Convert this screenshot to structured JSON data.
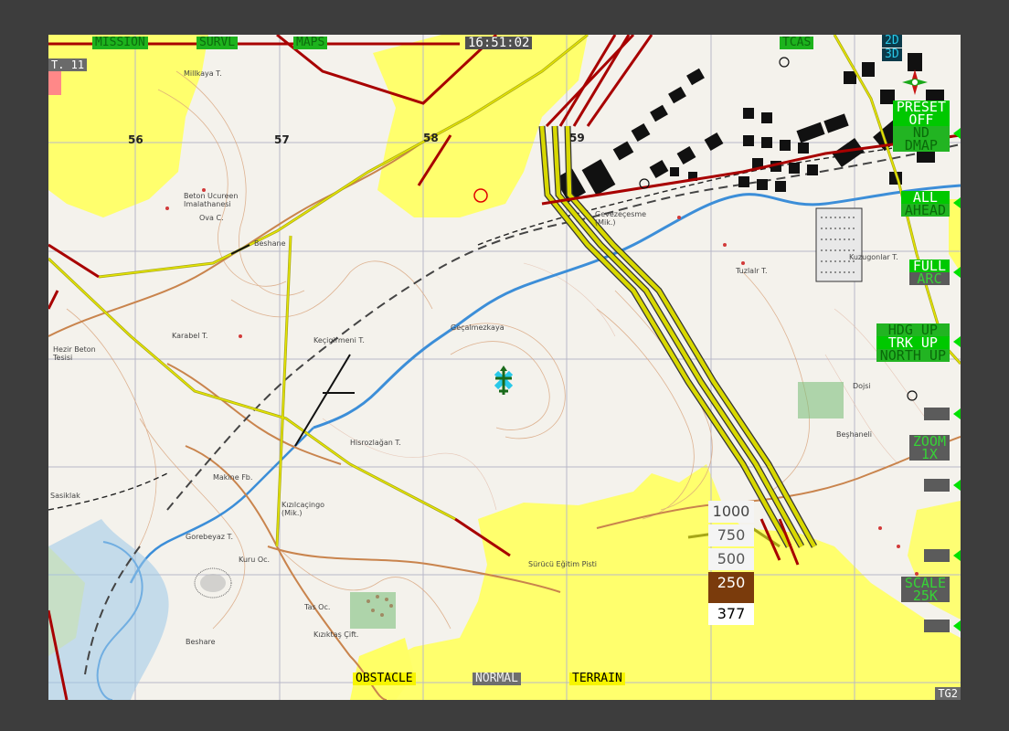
{
  "top_bar": {
    "mission": "MISSION",
    "survl": "SURVL",
    "maps": "MAPS",
    "time": "16:51:02",
    "tcas": "TCAS"
  },
  "corner_tl": "T. 11",
  "corner_br": "TG2",
  "view_mode": {
    "mode_2d": "2D",
    "mode_3d": "3D"
  },
  "right_panel": {
    "preset": [
      "PRESET",
      "OFF",
      "ND",
      "DMAP"
    ],
    "ahead": [
      "ALL",
      "AHEAD"
    ],
    "arc": [
      "FULL",
      "ARC"
    ],
    "orientation": [
      "HDG UP",
      "TRK UP",
      "NORTH UP"
    ],
    "zoom": [
      "ZOOM",
      "1X"
    ],
    "scale": [
      "SCALE",
      "25K"
    ]
  },
  "bottom_bar": {
    "obstacle": "OBSTACLE",
    "normal": "NORMAL",
    "terrain": "TERRAIN"
  },
  "altitude_legend": {
    "values": [
      "1000",
      "750",
      "500",
      "250"
    ],
    "current": "377"
  },
  "grid_numbers": [
    "56",
    "57",
    "58",
    "59"
  ],
  "place_names": [
    "Millkaya T.",
    "Beton Ucureen Imalathanesi",
    "Ova C.",
    "Beshane",
    "Karabel T.",
    "Hezir Beton Tesisi",
    "Keçigirmeni T.",
    "Geçalmezkaya",
    "Gevezeçesme (Mik.)",
    "Tuzlalr T.",
    "Kuzugonlar T.",
    "Hisrozlağan T.",
    "Makine Fb.",
    "Gorebeyaz T.",
    "Kuru Oc.",
    "Tas Oc.",
    "Kızıktaş Çift.",
    "Sürücü Eğitim Pisti",
    "Beşhaneli",
    "Dojsi",
    "Sasiklak",
    "Beshare",
    "Kızılcaçingo (Mik.)"
  ],
  "colors": {
    "terrain_caution": "#ffff66",
    "powerline_yellow": "#d8d800",
    "powerline_red": "#a80000",
    "symbology_green": "#00c800",
    "alt_250_bg": "#7a3b0c"
  }
}
